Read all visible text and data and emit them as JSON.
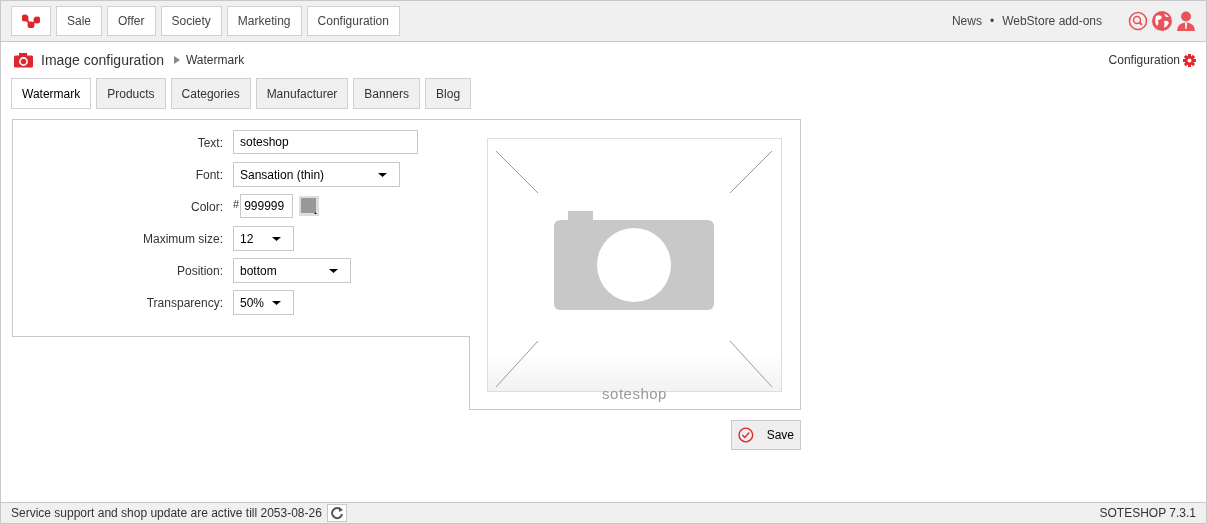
{
  "top_nav": {
    "items": [
      {
        "label": "Sale"
      },
      {
        "label": "Offer"
      },
      {
        "label": "Society"
      },
      {
        "label": "Marketing"
      },
      {
        "label": "Configuration"
      }
    ],
    "links": [
      "News",
      "WebStore add-ons"
    ],
    "separator": "•"
  },
  "breadcrumb": {
    "title": "Image configuration",
    "current": "Watermark",
    "config_link": "Configuration"
  },
  "tabs": [
    {
      "label": "Watermark",
      "selected": true
    },
    {
      "label": "Products",
      "selected": false
    },
    {
      "label": "Categories",
      "selected": false
    },
    {
      "label": "Manufacturer",
      "selected": false
    },
    {
      "label": "Banners",
      "selected": false
    },
    {
      "label": "Blog",
      "selected": false
    }
  ],
  "form": {
    "fields": [
      {
        "kind": "text",
        "label": "Text:",
        "value": "soteshop"
      },
      {
        "kind": "select",
        "label": "Font:",
        "value": "Sansation (thin)"
      },
      {
        "kind": "color",
        "label": "Color:",
        "prefix": "#",
        "value": "999999"
      },
      {
        "kind": "select",
        "label": "Maximum size:",
        "value": "12"
      },
      {
        "kind": "select",
        "label": "Position:",
        "value": "bottom"
      },
      {
        "kind": "select",
        "label": "Transparency:",
        "value": "50%"
      }
    ]
  },
  "preview": {
    "watermark_text": "soteshop"
  },
  "save_button": "Save",
  "status_bar": {
    "message": "Service support and shop update are active till 2053-08-26",
    "version": "SOTESHOP 7.3.1"
  }
}
